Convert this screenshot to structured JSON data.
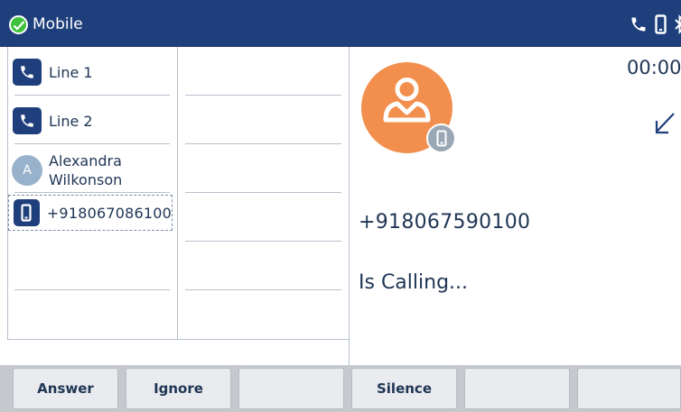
{
  "header": {
    "title": "Mobile",
    "status_icon": "check-circle-icon",
    "status_color": "#3ec23b",
    "icons": [
      "phone-icon",
      "mobile-icon",
      "bluetooth-icon"
    ],
    "background": "#1f3f7c"
  },
  "lines": {
    "items": [
      {
        "label": "Line 1",
        "icon": "phone-icon"
      },
      {
        "label": "Line 2",
        "icon": "phone-icon"
      }
    ],
    "contact": {
      "initial": "A",
      "name": "Alexandra Wilkonson"
    },
    "active": {
      "label": "+918067086100",
      "icon": "mobile-icon"
    }
  },
  "call": {
    "timer": "00:00",
    "direction_icon": "incoming-arrow-icon",
    "number": "+918067590100",
    "status": "Is Calling...",
    "avatar_color": "#f28f4e",
    "badge_icon": "mobile-icon"
  },
  "softkeys": {
    "answer": "Answer",
    "ignore": "Ignore",
    "silence": "Silence"
  }
}
